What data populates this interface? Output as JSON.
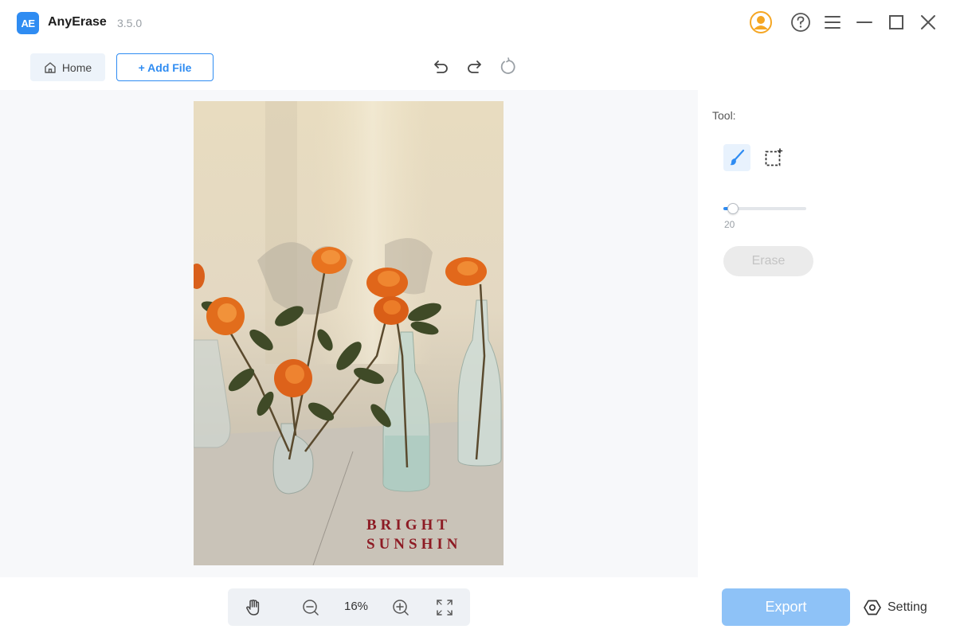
{
  "app": {
    "logo_text": "AE",
    "name": "AnyErase",
    "version": "3.5.0"
  },
  "window_controls": {
    "icons": [
      "account-icon",
      "help-icon",
      "menu-icon",
      "minimize-icon",
      "maximize-icon",
      "close-icon"
    ],
    "account_color": "#f5a623"
  },
  "toolbar": {
    "home_label": "Home",
    "add_file_label": "+ Add File",
    "history_icons": [
      "undo-icon",
      "redo-icon",
      "reset-icon"
    ]
  },
  "image": {
    "watermark_lines": [
      "BRIGHT",
      "SUNSHIN"
    ]
  },
  "tool_panel": {
    "label": "Tool:",
    "tools": [
      {
        "name": "brush",
        "icon": "brush-icon",
        "active": true
      },
      {
        "name": "rect-select",
        "icon": "rectangle-select-icon",
        "active": false
      }
    ],
    "brush_size": "20",
    "brush_size_fraction": 0.05,
    "erase_label": "Erase"
  },
  "zoom": {
    "value": "16%",
    "icons": [
      "hand-icon",
      "zoom-out-icon",
      "zoom-in-icon",
      "fit-screen-icon"
    ]
  },
  "footer": {
    "export_label": "Export",
    "setting_label": "Setting"
  },
  "colors": {
    "accent": "#2f8cf2",
    "export_button": "#8ec2f7",
    "watermark": "#8d1b24"
  }
}
